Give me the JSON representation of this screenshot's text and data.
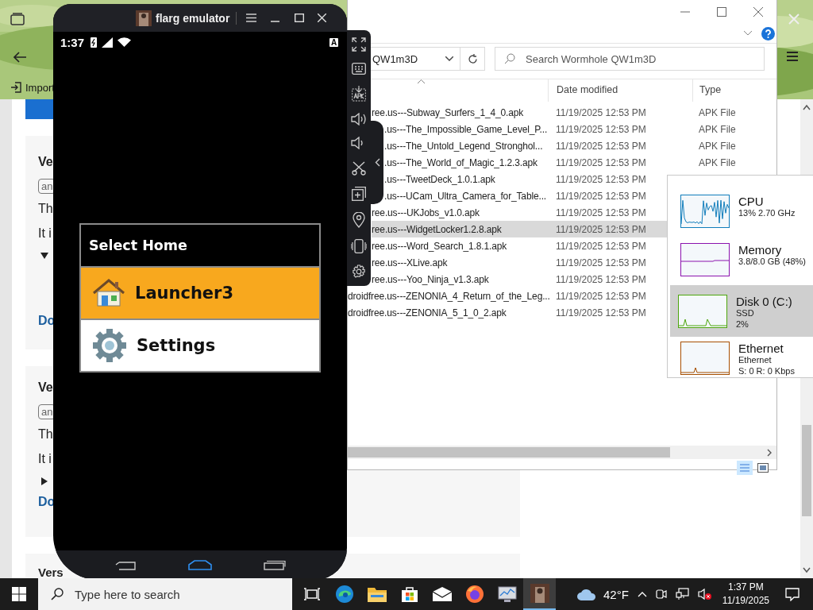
{
  "browser": {
    "toolbar": {
      "import_label": "Import"
    },
    "cards": [
      {
        "title": "Ve",
        "tag": "an",
        "line_1": "Th",
        "line_2": "It i",
        "expanded": true,
        "link": "Do"
      },
      {
        "title": "Ve",
        "tag": "an",
        "line_1": "Th",
        "line_2": "It i",
        "expanded": false,
        "link": "Do"
      },
      {
        "title": "Vers"
      }
    ]
  },
  "explorer": {
    "address": "QW1m3D",
    "search_placeholder": "Search Wormhole QW1m3D",
    "columns": [
      {
        "label": "Date modified"
      },
      {
        "label": "Type"
      }
    ],
    "rows": [
      {
        "name": "ree.us---Subway_Surfers_1_4_0.apk",
        "date": "11/19/2025 12:53 PM",
        "type": "APK File",
        "selected": false
      },
      {
        "name": ".us---The_Impossible_Game_Level_P...",
        "date": "11/19/2025 12:53 PM",
        "type": "APK File",
        "selected": false
      },
      {
        "name": ".us---The_Untold_Legend_Stronghol...",
        "date": "11/19/2025 12:53 PM",
        "type": "APK File",
        "selected": false
      },
      {
        "name": ".us---The_World_of_Magic_1.2.3.apk",
        "date": "11/19/2025 12:53 PM",
        "type": "APK File",
        "selected": false
      },
      {
        "name": ".us---TweetDeck_1.0.1.apk",
        "date": "11/19/2025 12:53 PM",
        "selected": false
      },
      {
        "name": ".us---UCam_Ultra_Camera_for_Table...",
        "date": "11/19/2025 12:53 PM",
        "selected": false
      },
      {
        "name": "ree.us---UKJobs_v1.0.apk",
        "date": "11/19/2025 12:53 PM",
        "selected": false
      },
      {
        "name": "ree.us---WidgetLocker1.2.8.apk",
        "date": "11/19/2025 12:53 PM",
        "selected": true
      },
      {
        "name": "ree.us---Word_Search_1.8.1.apk",
        "date": "11/19/2025 12:53 PM",
        "selected": false
      },
      {
        "name": "ree.us---XLive.apk",
        "date": "11/19/2025 12:53 PM",
        "selected": false
      },
      {
        "name": "ree.us---Yoo_Ninja_v1.3.apk",
        "date": "11/19/2025 12:53 PM",
        "selected": false
      },
      {
        "name": "droidfree.us---ZENONIA_4_Return_of_the_Leg...",
        "date": "11/19/2025 12:53 PM",
        "selected": false
      },
      {
        "name": "droidfree.us---ZENONIA_5_1_0_2.apk",
        "date": "11/19/2025 12:53 PM",
        "selected": false
      }
    ]
  },
  "emulator": {
    "title": "flarg emulator",
    "status_time": "1:37",
    "keyboard_badge": "A",
    "dialog": {
      "title": "Select Home",
      "options": [
        {
          "kind": "launcher",
          "label": "Launcher3",
          "selected": true
        },
        {
          "kind": "settings",
          "label": "Settings",
          "selected": false
        }
      ]
    }
  },
  "task_manager": {
    "items": [
      {
        "name": "CPU",
        "details": [
          "13% 2.70 GHz"
        ],
        "color": "#117dbb",
        "selected": false
      },
      {
        "name": "Memory",
        "details": [
          "3.8/8.0 GB (48%)"
        ],
        "color": "#8b12ae",
        "selected": false
      },
      {
        "name": "Disk 0 (C:)",
        "details": [
          "SSD",
          "2%"
        ],
        "color": "#4da60c",
        "selected": true
      },
      {
        "name": "Ethernet",
        "details": [
          "Ethernet",
          "S: 0 R: 0 Kbps"
        ],
        "color": "#a74f01",
        "selected": false
      }
    ]
  },
  "taskbar": {
    "search_placeholder": "Type here to search",
    "apps": [
      {
        "kind": "task-view",
        "active": false
      },
      {
        "kind": "edge",
        "active": false
      },
      {
        "kind": "folder",
        "active": false
      },
      {
        "kind": "store",
        "active": false
      },
      {
        "kind": "mail",
        "active": false
      },
      {
        "kind": "firefox",
        "active": false
      },
      {
        "kind": "monitor",
        "active": false
      },
      {
        "kind": "emulator",
        "active": true
      }
    ],
    "weather": "42°F",
    "time": "1:37 PM",
    "date": "11/19/2025"
  }
}
